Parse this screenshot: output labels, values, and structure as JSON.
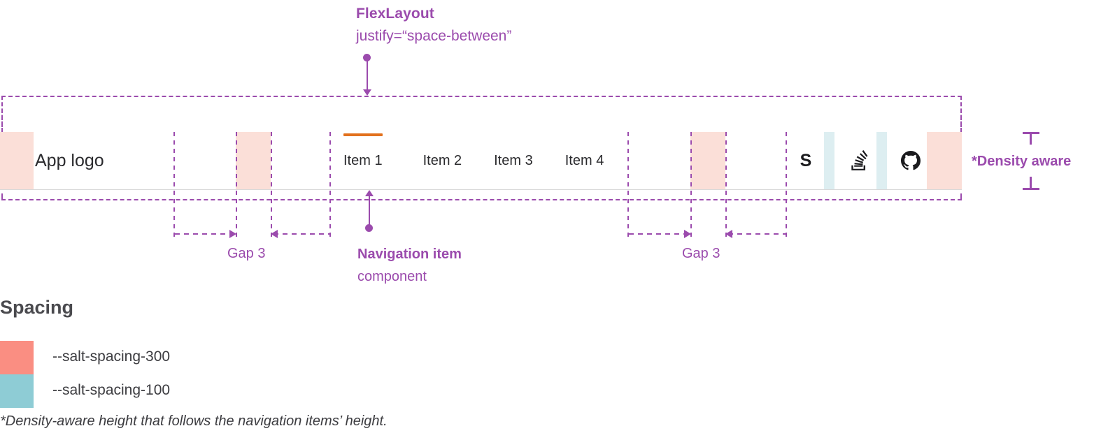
{
  "annotations": {
    "flex_layout": {
      "line1": "FlexLayout",
      "line2": "justify=“space-between”"
    },
    "nav_item_component": {
      "line1": "Navigation item",
      "line2": "component"
    },
    "gap_left": "Gap 3",
    "gap_right": "Gap 3",
    "density_aware": "*Density aware"
  },
  "navbar": {
    "app_logo": "App logo",
    "items": [
      {
        "label": "Item 1",
        "active": true
      },
      {
        "label": "Item 2",
        "active": false
      },
      {
        "label": "Item 3",
        "active": false
      },
      {
        "label": "Item 4",
        "active": false
      }
    ],
    "icons": [
      {
        "name": "salt-logo-icon",
        "label": "S"
      },
      {
        "name": "stackoverflow-icon",
        "label": "Stack Overflow"
      },
      {
        "name": "github-icon",
        "label": "GitHub"
      }
    ],
    "active_indicator_color": "#E2711D"
  },
  "legend": {
    "title": "Spacing",
    "items": [
      {
        "swatch": "#FA8E82",
        "token": "--salt-spacing-300"
      },
      {
        "swatch": "#8ECCD5",
        "token": "--salt-spacing-100"
      }
    ]
  },
  "footnote": "*Density-aware height that follows the navigation items’ height.",
  "colors": {
    "annotation": "#9B4BAD",
    "spacing_300_overlay": "#FBDFD8",
    "spacing_100_overlay": "#DDEEF1"
  }
}
